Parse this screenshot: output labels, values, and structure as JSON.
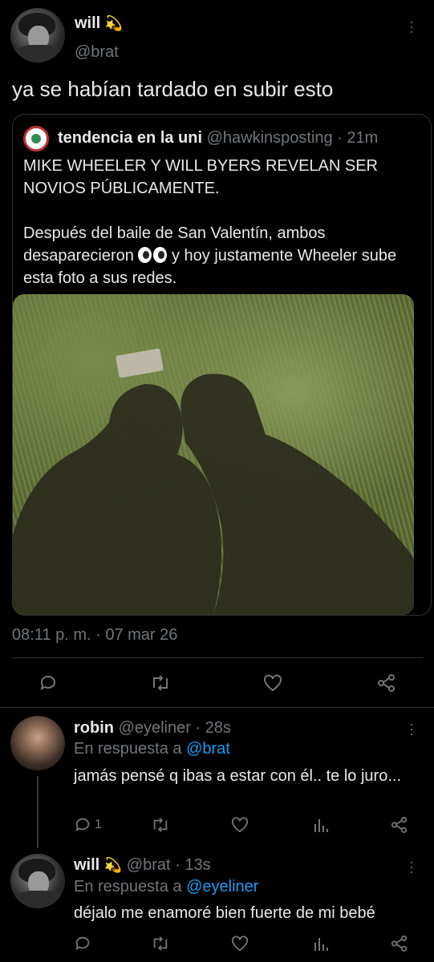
{
  "main_tweet": {
    "name": "will",
    "name_emoji": "💫",
    "handle": "@brat",
    "text": "ya se habían tardado en subir esto",
    "timestamp": "08:11 p. m. · 07 mar 26"
  },
  "quote": {
    "name": "tendencia en la uni",
    "handle_time": "@hawkinsposting · 21m",
    "paragraph1": "MIKE WHEELER Y WILL BYERS REVELAN SER NOVIOS PÚBLICAMENTE.",
    "paragraph2_before": "Después del baile de San Valentín, ambos desaparecieron",
    "paragraph2_after": "y hoy justamente Wheeler sube esta foto a sus redes."
  },
  "reply1": {
    "name": "robin",
    "handle_time": "@eyeliner · 28s",
    "reply_prefix": "En respuesta a",
    "reply_to": "@brat",
    "text": "jamás pensé q ibas a estar con él.. te lo juro...",
    "reply_count": "1"
  },
  "reply2": {
    "name": "will",
    "name_emoji": "💫",
    "handle_time": "@brat · 13s",
    "reply_prefix": "En respuesta a",
    "reply_to": "@eyeliner",
    "text": "déjalo me enamoré bien fuerte de mi bebé"
  },
  "colors": {
    "background": "#000000",
    "text": "#e7e9ea",
    "muted": "#71767b",
    "link": "#1d9bf0",
    "border": "#2f3336"
  }
}
